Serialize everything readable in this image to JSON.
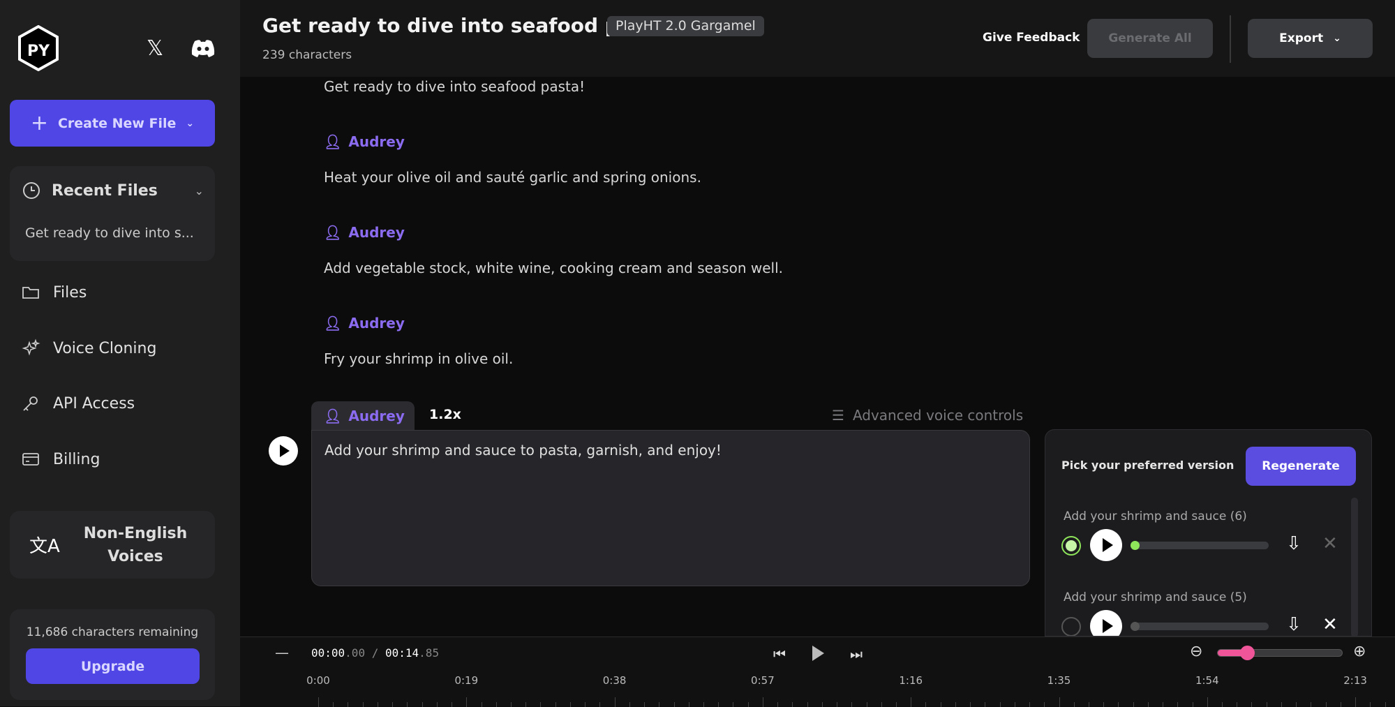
{
  "sidebar": {
    "create_label": "Create New File",
    "recent": {
      "title": "Recent Files",
      "items": [
        "Get ready to dive into s..."
      ]
    },
    "nav": [
      {
        "label": "Files",
        "icon": "folder-icon"
      },
      {
        "label": "Voice Cloning",
        "icon": "sparkles-icon"
      },
      {
        "label": "API Access",
        "icon": "key-icon"
      },
      {
        "label": "Billing",
        "icon": "credit-card-icon"
      }
    ],
    "non_english": "Non-English Voices",
    "remaining": "11,686 characters remaining",
    "upgrade_label": "Upgrade"
  },
  "header": {
    "title": "Get ready to dive into seafood p...",
    "model_badge": "PlayHT 2.0 Gargamel",
    "char_count": "239 characters",
    "feedback_label": "Give Feedback",
    "generate_all_label": "Generate All",
    "export_label": "Export"
  },
  "script": {
    "speaker": "Audrey",
    "lines": [
      "Get ready to dive into seafood pasta!",
      "Heat your olive oil and sauté garlic and spring onions.",
      "Add vegetable stock, white wine, cooking cream and season well.",
      "Fry your shrimp in olive oil."
    ],
    "active": {
      "speaker": "Audrey",
      "speed": "1.2x",
      "advanced_label": "Advanced voice controls",
      "text": "Add your shrimp and sauce to pasta, garnish, and enjoy!"
    }
  },
  "versions": {
    "title": "Pick your preferred version",
    "regenerate_label": "Regenerate",
    "items": [
      {
        "label": "Add your shrimp and sauce (6)",
        "selected": true,
        "progress": 0
      },
      {
        "label": "Add your shrimp and sauce (5)",
        "selected": false,
        "progress": 0
      }
    ]
  },
  "player": {
    "current_main": "00:00",
    "current_frac": ".00",
    "sep": "/",
    "total_main": "00:14",
    "total_frac": ".85",
    "zoom_level": 0.18,
    "timeline": [
      "0:00",
      "0:19",
      "0:38",
      "0:57",
      "1:16",
      "1:35",
      "1:54",
      "2:13"
    ]
  },
  "colors": {
    "accent": "#4f46e5",
    "speaker": "#8b6cf0",
    "selected": "#8ee55a",
    "zoom_slider": "#f0559a"
  }
}
